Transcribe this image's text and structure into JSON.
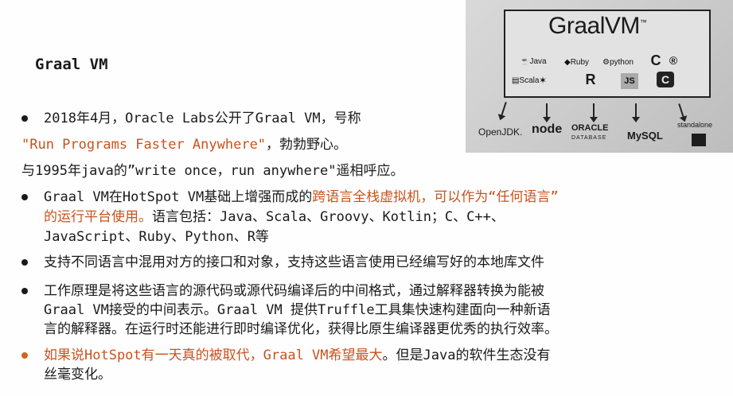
{
  "title": "Graal VM",
  "lines": {
    "l1": "2018年4月，Oracle Labs公开了Graal VM，号称",
    "l2": "\"Run Programs Faster Anywhere\"",
    "l2b": "，勃勃野心。",
    "l3": "与1995年java的”write once，run anywhere\"遥相呼应。",
    "l4a": "Graal VM在HotSpot VM基础上增强而成的",
    "l4b": "跨语言全栈虚拟机，可以作为“任何语言”",
    "l5a": "的运行平台使用。",
    "l5b": "语言包括：Java、Scala、Groovy、Kotlin；C、C++、",
    "l6": "JavaScript、Ruby、Python、R等",
    "l7": "支持不同语言中混用对方的接口和对象，支持这些语言使用已经编写好的本地库文件",
    "l8": "工作原理是将这些语言的源代码或源代码编译后的中间格式，通过解释器转换为能被",
    "l9": "Graal VM接受的中间表示。Graal VM 提供Truffle工具集快速构建面向一种新语",
    "l10": "言的解释器。在运行时还能进行即时编译优化，获得比原生编译器更优秀的执行效率。",
    "l11a": "如果说HotSpot有一天真的被取代，Graal VM希望最大",
    "l11b": "。但是Java的软件生态没有",
    "l12": "丝毫变化。"
  },
  "photo": {
    "heading": "GraalVM",
    "tm": "™",
    "langs": [
      "Java",
      "Ruby",
      "python",
      "Scala",
      "JS"
    ],
    "targets": [
      "OpenJDK.",
      "node",
      "ORACLE",
      "DATABASE",
      "MySQL",
      "standalone"
    ]
  },
  "colors": {
    "accent": "#c8531e",
    "text": "#1a1a1a"
  }
}
